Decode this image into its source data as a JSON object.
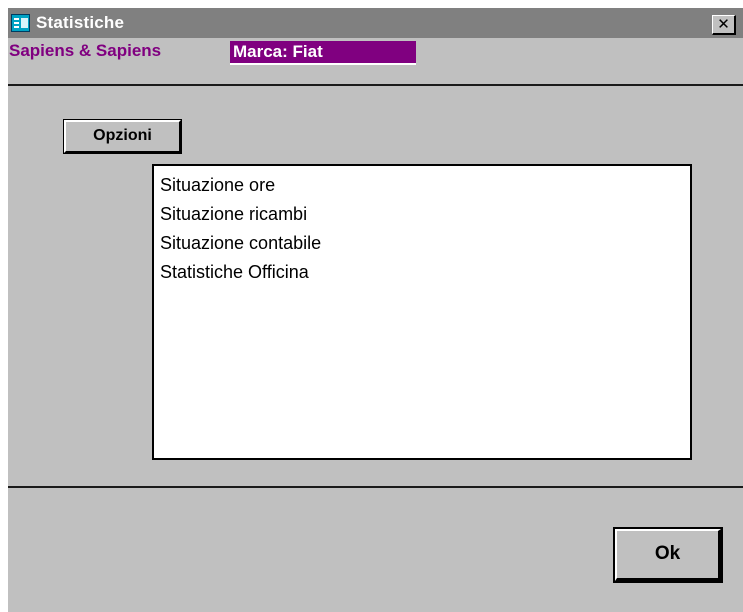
{
  "window": {
    "title": "Statistiche",
    "icon": "form-window-icon",
    "close_glyph": "✕"
  },
  "header": {
    "company": "Sapiens & Sapiens",
    "brand_label": "Marca: Fiat"
  },
  "toolbar": {
    "options_label": "Opzioni"
  },
  "statistics_list": {
    "items": [
      {
        "label": "Situazione ore"
      },
      {
        "label": "Situazione ricambi"
      },
      {
        "label": "Situazione contabile"
      },
      {
        "label": "Statistiche Officina"
      }
    ]
  },
  "footer": {
    "ok_label": "Ok"
  },
  "colors": {
    "titlebar_inactive": "#808080",
    "window_face": "#c0c0c0",
    "brand_accent": "#800080"
  }
}
